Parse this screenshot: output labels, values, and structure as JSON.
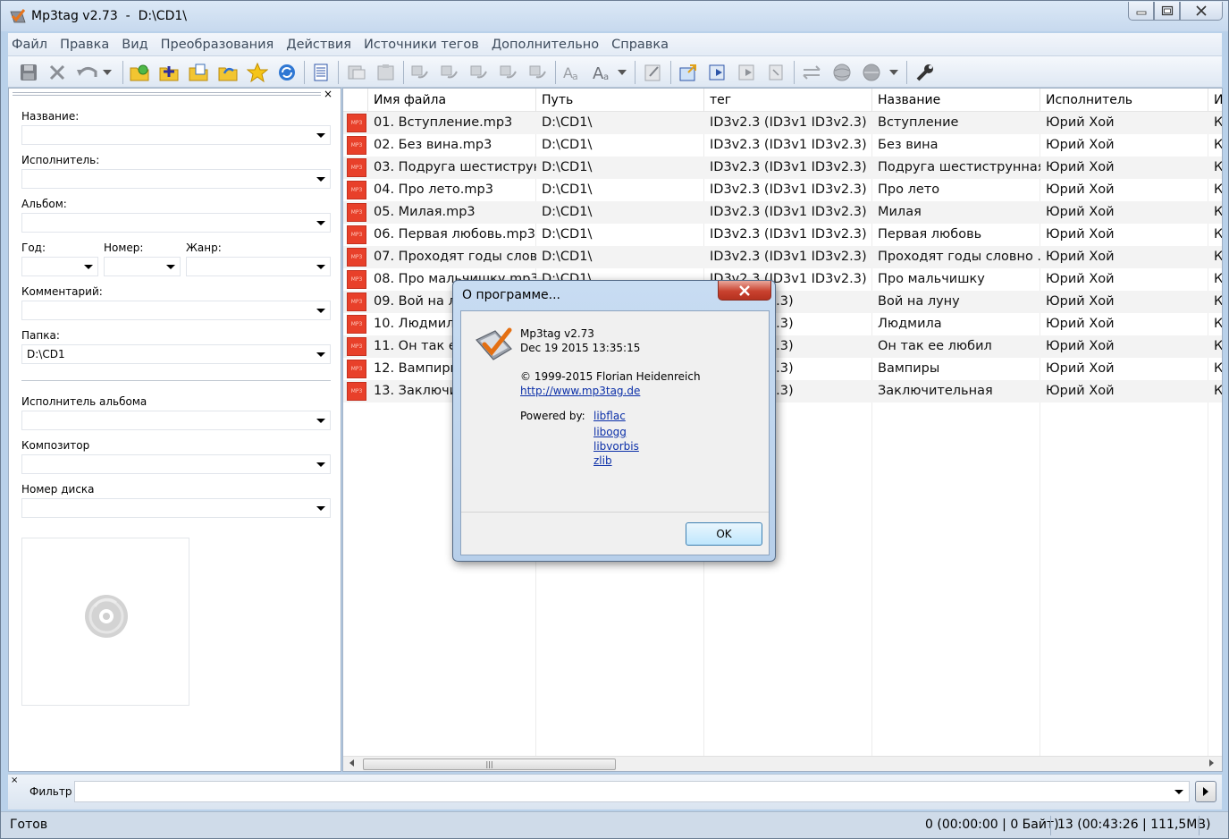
{
  "window": {
    "title": "Mp3tag v2.73  -  D:\\CD1\\"
  },
  "menu": [
    "Файл",
    "Правка",
    "Вид",
    "Преобразования",
    "Действия",
    "Источники тегов",
    "Дополнительно",
    "Справка"
  ],
  "left_panel": {
    "fields": {
      "title_label": "Название:",
      "artist_label": "Исполнитель:",
      "album_label": "Альбом:",
      "year_label": "Год:",
      "track_label": "Номер:",
      "genre_label": "Жанр:",
      "comment_label": "Комментарий:",
      "folder_label": "Папка:",
      "folder_value": "D:\\CD1",
      "album_artist_label": "Исполнитель альбома",
      "composer_label": "Композитор",
      "disc_label": "Номер диска"
    },
    "close_glyph": "×"
  },
  "grid": {
    "columns": [
      "Имя файла",
      "Путь",
      "тег",
      "Название",
      "Исполнитель",
      "И"
    ],
    "file_icon_text": "MP3",
    "rows": [
      {
        "file": "01. Вступление.mp3",
        "path": "D:\\CD1\\",
        "tag": "ID3v2.3 (ID3v1 ID3v2.3)",
        "title": "Вступление",
        "artist": "Юрий Хой",
        "extra": "К"
      },
      {
        "file": "02. Без вина.mp3",
        "path": "D:\\CD1\\",
        "tag": "ID3v2.3 (ID3v1 ID3v2.3)",
        "title": "Без вина",
        "artist": "Юрий Хой",
        "extra": "К"
      },
      {
        "file": "03. Подруга шестиструн...",
        "path": "D:\\CD1\\",
        "tag": "ID3v2.3 (ID3v1 ID3v2.3)",
        "title": "Подруга шестиструнная",
        "artist": "Юрий Хой",
        "extra": "К"
      },
      {
        "file": "04. Про лето.mp3",
        "path": "D:\\CD1\\",
        "tag": "ID3v2.3 (ID3v1 ID3v2.3)",
        "title": "Про лето",
        "artist": "Юрий Хой",
        "extra": "К"
      },
      {
        "file": "05. Милая.mp3",
        "path": "D:\\CD1\\",
        "tag": "ID3v2.3 (ID3v1 ID3v2.3)",
        "title": "Милая",
        "artist": "Юрий Хой",
        "extra": "К"
      },
      {
        "file": "06. Первая любовь.mp3",
        "path": "D:\\CD1\\",
        "tag": "ID3v2.3 (ID3v1 ID3v2.3)",
        "title": "Первая любовь",
        "artist": "Юрий Хой",
        "extra": "К"
      },
      {
        "file": "07. Проходят годы слов...",
        "path": "D:\\CD1\\",
        "tag": "ID3v2.3 (ID3v1 ID3v2.3)",
        "title": "Проходят годы словно ...",
        "artist": "Юрий Хой",
        "extra": "К"
      },
      {
        "file": "08. Про мальчишку.mp3",
        "path": "D:\\CD1\\",
        "tag": "ID3v2.3 (ID3v1 ID3v2.3)",
        "title": "Про мальчишку",
        "artist": "Юрий Хой",
        "extra": "К"
      },
      {
        "file": "09. Вой на лу",
        "path": "",
        "tag": "3v1 ID3v2.3)",
        "title": "Вой на луну",
        "artist": "Юрий Хой",
        "extra": "К"
      },
      {
        "file": "10. Людмила",
        "path": "",
        "tag": "3v1 ID3v2.3)",
        "title": "Людмила",
        "artist": "Юрий Хой",
        "extra": "К"
      },
      {
        "file": "11. Он так ее",
        "path": "",
        "tag": "3v1 ID3v2.3)",
        "title": "Он так ее любил",
        "artist": "Юрий Хой",
        "extra": "К"
      },
      {
        "file": "12. Вампиры",
        "path": "",
        "tag": "3v1 ID3v2.3)",
        "title": "Вампиры",
        "artist": "Юрий Хой",
        "extra": "К"
      },
      {
        "file": "13. Заключит",
        "path": "",
        "tag": "3v1 ID3v2.3)",
        "title": "Заключительная",
        "artist": "Юрий Хой",
        "extra": "К"
      }
    ]
  },
  "filter": {
    "label": "Фильтр",
    "value": "",
    "close_glyph": "×"
  },
  "status": {
    "left": "Готов",
    "selection": "0 (00:00:00 | 0 Байт)",
    "total": "13 (00:43:26 | 111,5MB)"
  },
  "dialog": {
    "title": "О программе...",
    "app_name": "Mp3tag v2.73",
    "build_date": "Dec 19 2015 13:35:15",
    "copyright": "© 1999-2015 Florian Heidenreich",
    "website": "http://www.mp3tag.de",
    "powered_label": "Powered by:",
    "libs": [
      "libflac",
      "libogg",
      "libvorbis",
      "zlib"
    ],
    "ok_label": "OK"
  }
}
